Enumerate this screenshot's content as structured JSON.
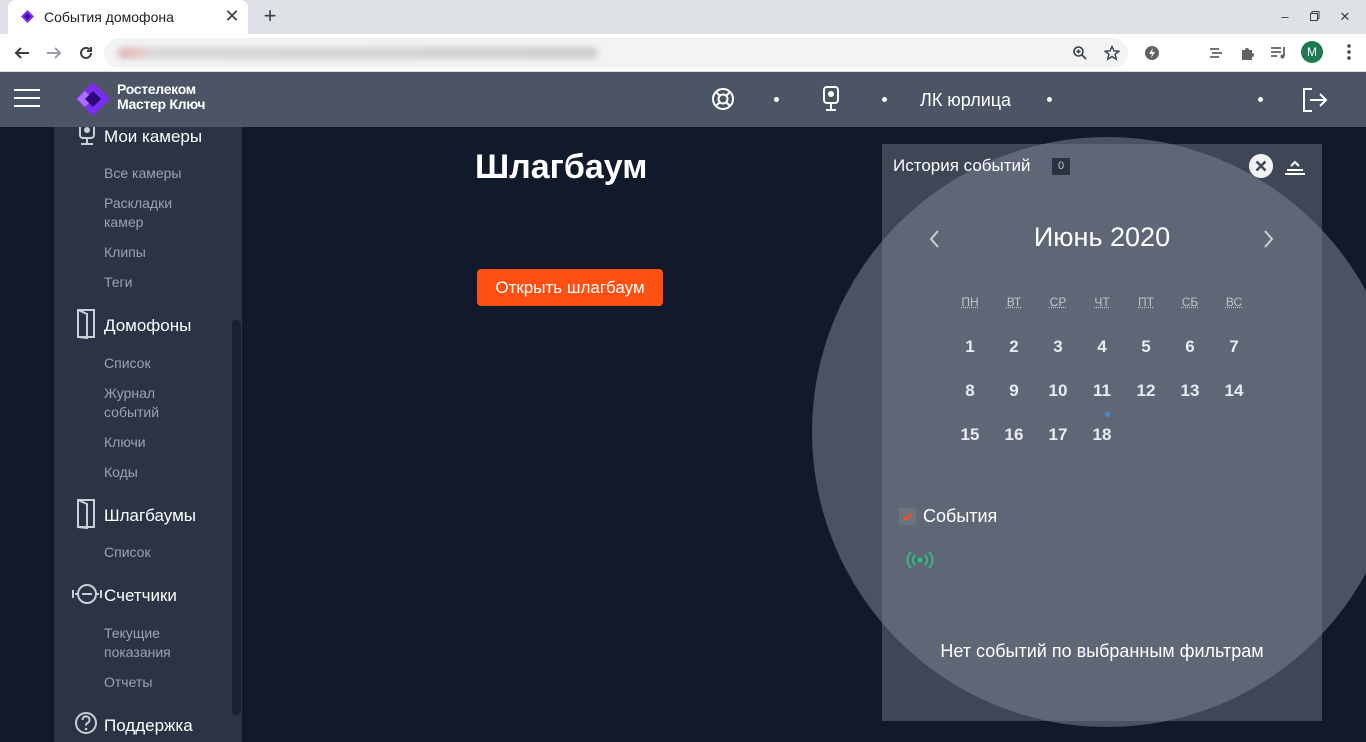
{
  "browser": {
    "tab_title": "События домофона",
    "tab_favicon": "rostelecom-favicon",
    "profile_initial": "M",
    "new_tab": "+",
    "tab_close": "✕"
  },
  "header": {
    "logo_line1": "Ростелеком",
    "logo_line2": "Мастер Ключ",
    "account_label": "ЛК юрлица",
    "icons": [
      "menu-icon",
      "support-lifebuoy-icon",
      "intercom-icon",
      "logout-icon"
    ]
  },
  "sidebar": {
    "sections": [
      {
        "title": "Мои камеры",
        "icon": "camera-icon",
        "items": [
          "Все камеры",
          "Раскладки камер",
          "Клипы",
          "Теги"
        ]
      },
      {
        "title": "Домофоны",
        "icon": "door-icon",
        "items": [
          "Список",
          "Журнал событий",
          "Ключи",
          "Коды"
        ]
      },
      {
        "title": "Шлагбаумы",
        "icon": "barrier-door-icon",
        "items": [
          "Список"
        ]
      },
      {
        "title": "Счетчики",
        "icon": "meter-icon",
        "items": [
          "Текущие показания",
          "Отчеты"
        ]
      },
      {
        "title": "Поддержка",
        "icon": "help-icon",
        "items": []
      }
    ]
  },
  "main": {
    "title": "Шлагбаум",
    "open_button": "Открыть шлагбаум"
  },
  "events_panel": {
    "title": "История событий",
    "count": "0",
    "calendar": {
      "month": "Июнь 2020",
      "weekdays": [
        "ПН",
        "ВТ",
        "СР",
        "ЧТ",
        "ПТ",
        "СБ",
        "ВС"
      ],
      "days": [
        "1",
        "2",
        "3",
        "4",
        "5",
        "6",
        "7",
        "8",
        "9",
        "10",
        "11",
        "12",
        "13",
        "14",
        "15",
        "16",
        "17",
        "18"
      ],
      "marked_day": "11"
    },
    "filter_label": "События",
    "filter_checked": true,
    "empty_message": "Нет событий по выбранным фильтрам"
  },
  "colors": {
    "accent": "#ff4f12",
    "page_bg": "#111a2b",
    "header_bg": "#4c5565",
    "sidebar_bg": "#2a3444",
    "panel_bg": "#3f4757",
    "event_green": "#2ec27e",
    "marked_day_dot": "#3f8bd6"
  }
}
